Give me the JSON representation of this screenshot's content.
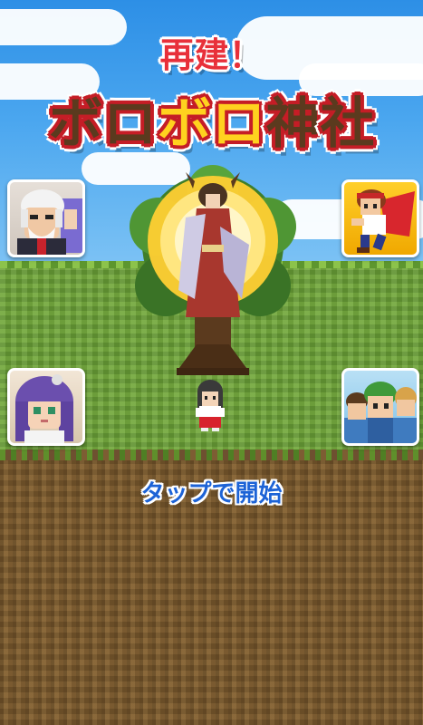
{
  "title": {
    "subtitle": "再建！",
    "main_chars": [
      {
        "text": "ボ",
        "color": "dark"
      },
      {
        "text": "ロ",
        "color": "dark"
      },
      {
        "text": "ボ",
        "color": "yellow"
      },
      {
        "text": "ロ",
        "color": "yellow"
      },
      {
        "text": "神",
        "color": "dark"
      },
      {
        "text": "社",
        "color": "dark"
      }
    ]
  },
  "prompt": {
    "tap_to_start": "タップで開始"
  },
  "colors": {
    "title_red": "#e8303a",
    "title_outline": "#c51d26",
    "title_brown": "#5b3a1e",
    "title_yellow": "#ffd21f",
    "tap_text_blue": "#1d63d6",
    "sky_blue": "#2d8fe6",
    "grass_green": "#6ea33a",
    "dirt_brown": "#7a5a30"
  },
  "side_buttons": [
    {
      "id": "old-man-game",
      "icon": "old-man-portrait-icon"
    },
    {
      "id": "hero-runner-game",
      "icon": "running-hero-portrait-icon"
    },
    {
      "id": "purple-hair-girl-game",
      "icon": "purple-hair-girl-portrait-icon"
    },
    {
      "id": "villagers-group-game",
      "icon": "villagers-group-portrait-icon"
    }
  ]
}
